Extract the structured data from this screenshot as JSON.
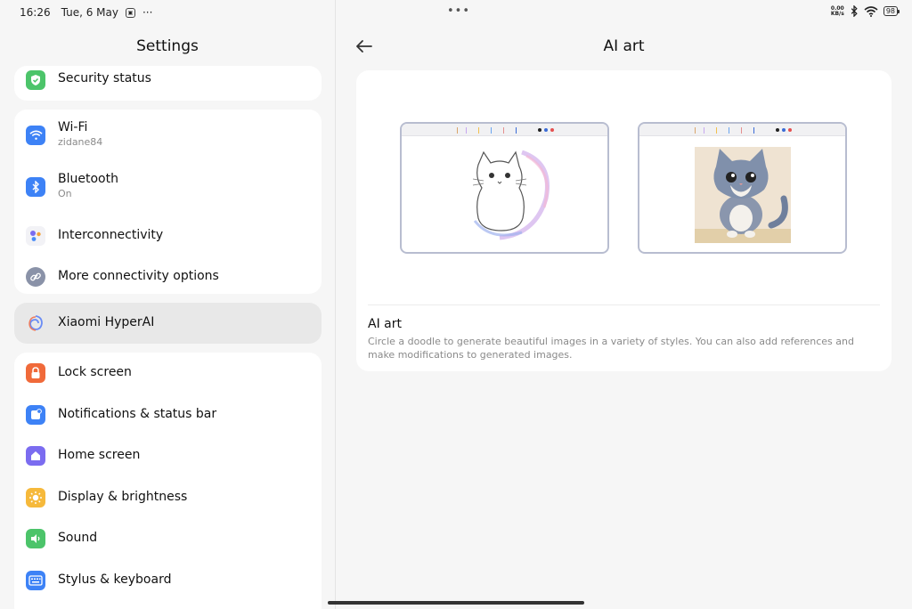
{
  "status_bar": {
    "time": "16:26",
    "date": "Tue, 6 May",
    "more": "···",
    "center_dots": "•••",
    "net_speed_value": "0.00",
    "net_speed_unit": "KB/s",
    "battery": "98"
  },
  "left": {
    "title": "Settings",
    "cards": [
      {
        "items": [
          {
            "label": "Security status",
            "icon": "shield-icon",
            "color": "#4cc46a"
          }
        ]
      },
      {
        "items": [
          {
            "label": "Wi-Fi",
            "sub": "zidane84",
            "icon": "wifi-icon",
            "color": "#3d82f6"
          },
          {
            "label": "Bluetooth",
            "sub": "On",
            "icon": "bluetooth-icon",
            "color": "#3d82f6"
          },
          {
            "label": "Interconnectivity",
            "icon": "interconnectivity-icon",
            "color": "#f2f2f6"
          },
          {
            "label": "More connectivity options",
            "icon": "link-icon",
            "color": "#8a92a8"
          }
        ]
      },
      {
        "items": [
          {
            "label": "Xiaomi HyperAI",
            "icon": "hyperai-icon",
            "color": "#e8e8e8"
          }
        ]
      },
      {
        "items": [
          {
            "label": "Lock screen",
            "icon": "lock-icon",
            "color": "#f06a3a"
          },
          {
            "label": "Notifications & status bar",
            "icon": "notification-icon",
            "color": "#3d82f6"
          },
          {
            "label": "Home screen",
            "icon": "home-icon",
            "color": "#7b6cf0"
          },
          {
            "label": "Display & brightness",
            "icon": "sun-icon",
            "color": "#f6b93b"
          },
          {
            "label": "Sound",
            "icon": "speaker-icon",
            "color": "#4cc46a"
          },
          {
            "label": "Stylus & keyboard",
            "icon": "keyboard-icon",
            "color": "#3d82f6"
          }
        ]
      }
    ]
  },
  "right": {
    "title": "AI art",
    "section_title": "AI art",
    "section_desc": "Circle a doodle to generate beautiful images in a variety of styles. You can also add references and make modifications to generated images."
  }
}
